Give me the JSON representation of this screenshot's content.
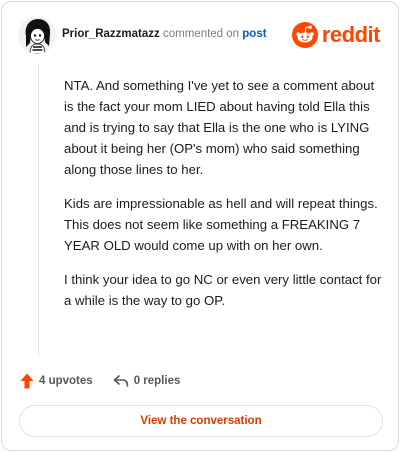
{
  "header": {
    "username": "Prior_Razzmatazz",
    "action_text": "commented on",
    "post_link": "post",
    "brand": "reddit"
  },
  "comment": {
    "paragraphs": [
      "NTA. And something I've yet to see a comment about is the fact your mom LIED about having told Ella this and is trying to say that Ella is the one who is LYING about it being her (OP's mom) who said something along those lines to her.",
      "Kids are impressionable as hell and will repeat things. This does not seem like something a FREAKING 7 YEAR OLD would come up with on her own.",
      "I think your idea to go NC or even very little contact for a while is the way to go OP."
    ]
  },
  "footer": {
    "upvotes": "4 upvotes",
    "replies": "0 replies",
    "cta_label": "View the conversation"
  },
  "colors": {
    "brand": "#ff4500",
    "upvote": "#ff4500",
    "link": "#0a58ca",
    "cta_text": "#d93a00"
  },
  "icons": {
    "avatar": "snoo-avatar",
    "brand": "reddit-logo-icon",
    "upvote": "upvote-arrow-icon",
    "reply": "reply-arrow-icon"
  }
}
